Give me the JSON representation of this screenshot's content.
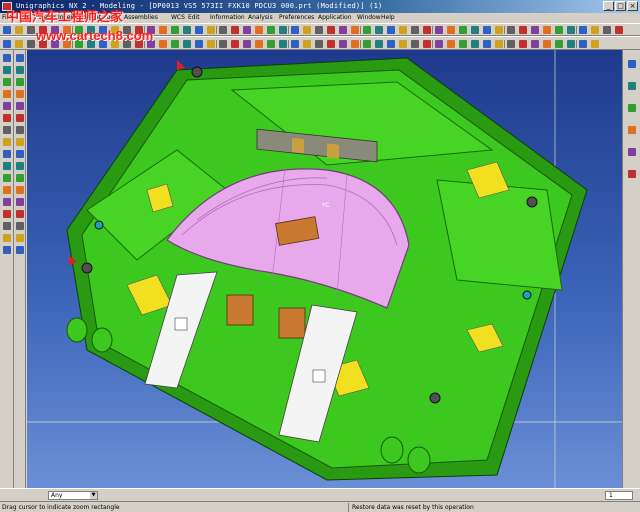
{
  "window": {
    "title": "Unigraphics NX 2 - Modeling - [DP0013 VS5 573II FXK10 PDCU3 000.prt (Modified)]  (1)",
    "minimize_label": "_",
    "maximize_label": "□",
    "close_label": "×"
  },
  "watermark": {
    "cn_text": "中国汽车工程师之家",
    "url_text": "www.cartech8.com"
  },
  "menu": {
    "items": [
      "File",
      "Edit",
      "View",
      "Insert",
      "Format",
      "Tools",
      "Assemblies",
      "WCS",
      "Edit",
      "Information",
      "Analysis",
      "Preferences",
      "Application",
      "Window",
      "Help"
    ]
  },
  "viewport": {
    "wcs_label": "YC",
    "colors": {
      "background_top": "#1e3a8c",
      "background_bottom": "#6b8fd6",
      "fixture_green": "#3cc81e",
      "panel_pink": "#e8a8ec",
      "accent_yellow": "#f0e020",
      "clamp_white": "#f4f4f4",
      "block_orange": "#c87830"
    }
  },
  "selection_bar": {
    "filter_value": "Any",
    "layer_value": "1"
  },
  "status": {
    "prompt": "Drag cursor to indicate zoom rectangle",
    "message": "Restore data was reset by this operation"
  },
  "icons": {
    "left_toolbar": [
      "point-icon",
      "line-icon",
      "arc-icon",
      "spline-icon",
      "sketch-icon",
      "extrude-icon",
      "revolve-icon",
      "hole-icon",
      "boss-icon",
      "pocket-icon",
      "pad-icon",
      "slot-icon",
      "groove-icon",
      "block-icon",
      "cylinder-icon",
      "cone-icon",
      "sphere-icon",
      "unite-icon",
      "subtract-icon",
      "intersect-icon",
      "blend-icon",
      "chamfer-icon",
      "shell-icon",
      "draft-icon",
      "offset-icon",
      "trim-icon",
      "split-icon",
      "mirror-icon",
      "pattern-icon",
      "measure-icon",
      "analyze-icon",
      "layer-icon",
      "color-icon",
      "hide-icon"
    ],
    "right_toolbar": [
      "assembly-navigator-icon",
      "part-navigator-icon",
      "roles-icon",
      "history-icon",
      "web-browser-icon",
      "palette-icon"
    ]
  }
}
